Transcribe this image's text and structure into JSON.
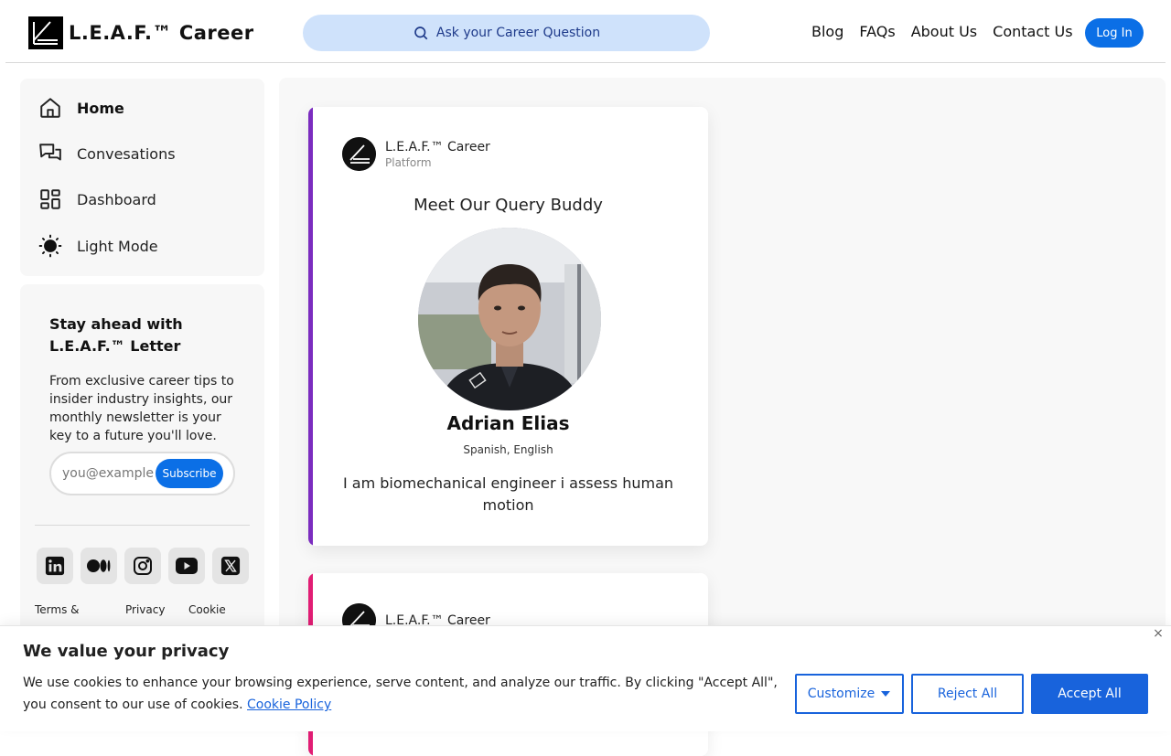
{
  "header": {
    "brand": "L.E.A.F.™ Career",
    "search_placeholder": "Ask your Career Question",
    "nav": [
      "Blog",
      "FAQs",
      "About Us",
      "Contact Us"
    ],
    "login_label": "Log In"
  },
  "sidebar": {
    "items": [
      {
        "label": "Home",
        "icon": "home-icon",
        "active": true
      },
      {
        "label": "Convesations",
        "icon": "chat-icon",
        "active": false
      },
      {
        "label": "Dashboard",
        "icon": "dashboard-icon",
        "active": false
      },
      {
        "label": "Light Mode",
        "icon": "sun-icon",
        "active": false
      }
    ]
  },
  "newsletter": {
    "title": "Stay ahead with L.E.A.F.™ Letter",
    "description": "From exclusive career tips to insider industry insights, our monthly newsletter is your key to a future you'll love.",
    "email_placeholder": "you@example.com",
    "subscribe_label": "Subscribe",
    "socials": [
      "linkedin-icon",
      "medium-icon",
      "instagram-icon",
      "youtube-icon",
      "x-icon"
    ],
    "legal": [
      "Terms &",
      "Privacy",
      "Cookie"
    ]
  },
  "cards": [
    {
      "org_name": "L.E.A.F.™ Career",
      "org_type": "Platform",
      "title": "Meet Our Query Buddy",
      "person_name": "Adrian Elias",
      "languages": "Spanish, English",
      "bio": "I am biomechanical engineer i assess human motion",
      "accent": "#7b2cbf"
    },
    {
      "org_name": "L.E.A.F.™ Career",
      "accent": "#e11d74"
    }
  ],
  "cookie": {
    "title": "We value your privacy",
    "text": "We use cookies to enhance your browsing experience, serve content, and analyze our traffic. By clicking \"Accept All\", you consent to our use of cookies.",
    "link": "Cookie Policy",
    "customize_label": "Customize",
    "reject_label": "Reject All",
    "accept_label": "Accept All",
    "close": "×"
  },
  "colors": {
    "primary": "#0b6fe6",
    "cookie_blue": "#1863dc",
    "search_bg": "#cfe2fb"
  }
}
